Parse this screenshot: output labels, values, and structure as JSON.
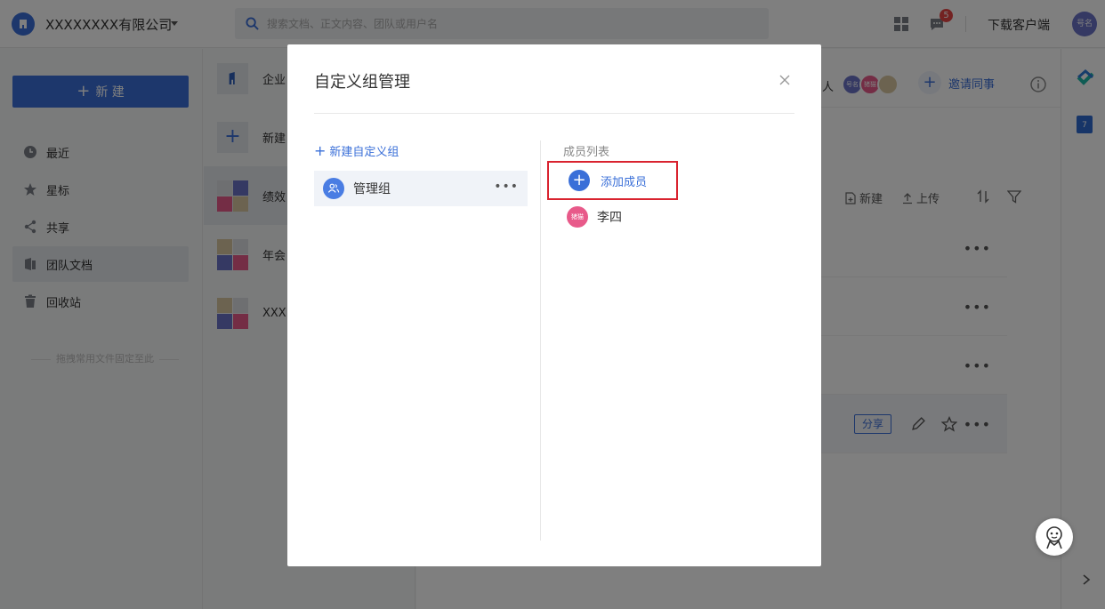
{
  "topbar": {
    "company_name": "XXXXXXXX有限公司",
    "search_placeholder": "搜索文档、正文内容、团队或用户名",
    "message_count": "5",
    "download_label": "下载客户端",
    "user_avatar_text": "号名"
  },
  "sidebar": {
    "new_label": "新 建",
    "items": [
      {
        "label": "最近",
        "icon": "clock-icon"
      },
      {
        "label": "星标",
        "icon": "star-icon"
      },
      {
        "label": "共享",
        "icon": "share-icon"
      },
      {
        "label": "团队文档",
        "icon": "team-docs-icon"
      },
      {
        "label": "回收站",
        "icon": "trash-icon"
      }
    ],
    "pin_hint": "拖拽常用文件固定至此"
  },
  "midlist": {
    "items": [
      {
        "label": "企业"
      },
      {
        "label": "新建"
      },
      {
        "label": "绩效"
      },
      {
        "label": "年会"
      },
      {
        "label": "XXX"
      }
    ]
  },
  "main": {
    "members_suffix": "人",
    "member_avatars": [
      "号名",
      "猪猫",
      ""
    ],
    "invite_label": "邀请同事",
    "toolbar_new": "新建",
    "toolbar_upload": "上传",
    "share_tag": "分享"
  },
  "modal": {
    "title": "自定义组管理",
    "new_group_label": "新建自定义组",
    "group_name": "管理组",
    "members_heading": "成员列表",
    "add_member_label": "添加成员",
    "members": [
      {
        "name": "李四",
        "avatar_text": "猪猫"
      }
    ]
  },
  "colors": {
    "accent": "#3a6fd8",
    "highlight_border": "#d9232f",
    "badge": "#e64545"
  }
}
